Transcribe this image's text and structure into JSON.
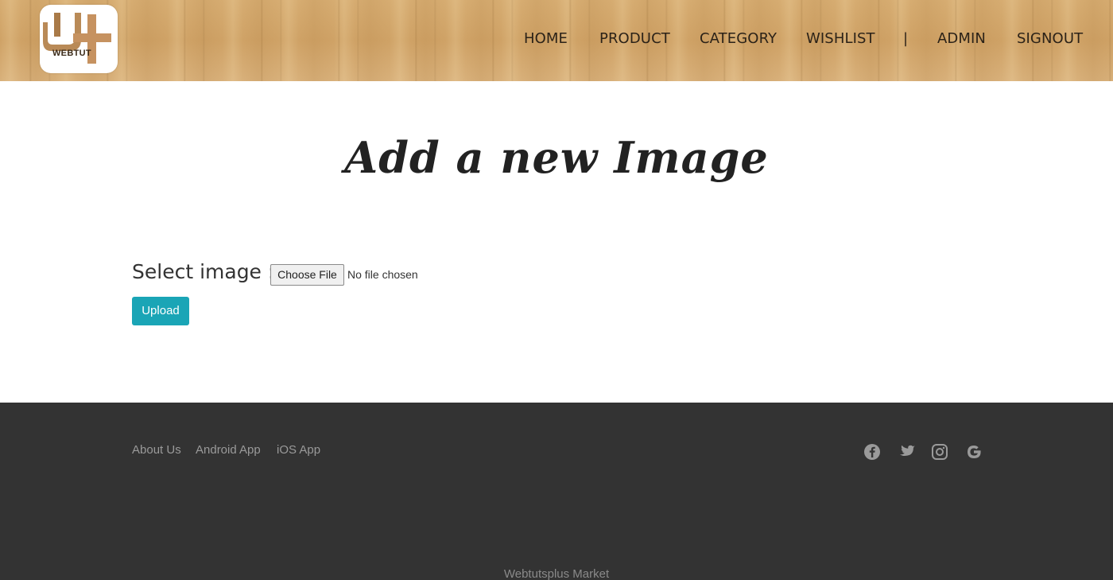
{
  "header": {
    "logo_text": "WEBTUT",
    "nav": [
      {
        "label": "HOME"
      },
      {
        "label": "PRODUCT"
      },
      {
        "label": "CATEGORY"
      },
      {
        "label": "WISHLIST"
      },
      {
        "label": "|"
      },
      {
        "label": "ADMIN"
      },
      {
        "label": "SIGNOUT"
      }
    ]
  },
  "main": {
    "title": "Add a new Image",
    "select_label": "Select image :",
    "file_button_label": "Choose File",
    "file_status": "No file chosen",
    "upload_label": "Upload"
  },
  "footer": {
    "links": [
      {
        "label": "About Us"
      },
      {
        "label": "Android App"
      },
      {
        "label": "iOS App"
      }
    ],
    "social_icons": [
      "facebook-icon",
      "twitter-icon",
      "instagram-icon",
      "google-icon"
    ],
    "copyright": "Webtutsplus Market"
  },
  "colors": {
    "upload_button": "#1aa5b6",
    "footer_bg": "#333333",
    "header_wood": "#d6ac71"
  }
}
